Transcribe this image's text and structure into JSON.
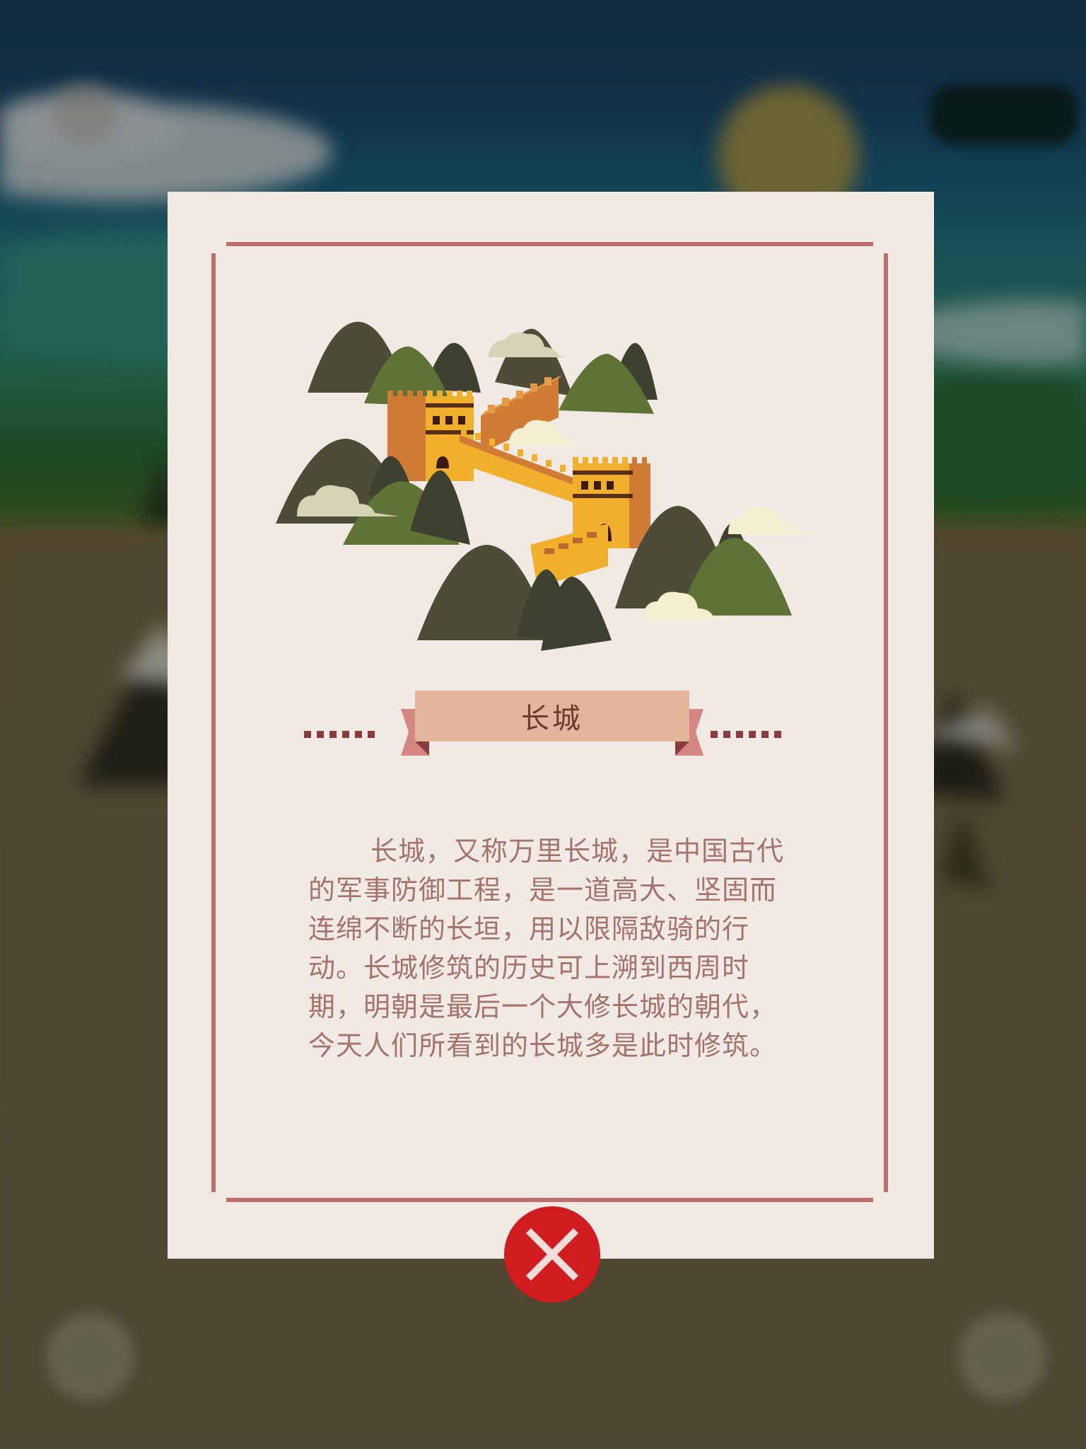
{
  "modal": {
    "title": "长城",
    "description": "长城，又称万里长城，是中国古代的军事防御工程，是一道高大、坚固而连绵不断的长垣，用以限隔敌骑的行动。长城修筑的历史可上溯到西周时期，明朝是最后一个大修长城的朝代，今天人们所看到的长城多是此时修筑。",
    "illustration": "great-wall-illustration",
    "close_icon": "close-icon"
  },
  "colors": {
    "card_bg": "#f0e9e4",
    "frame": "#bf6e6e",
    "ribbon": "#e3b59c",
    "title_text": "#6e3a30",
    "body_text": "#a4746a",
    "close_button": "#d01b1f"
  }
}
